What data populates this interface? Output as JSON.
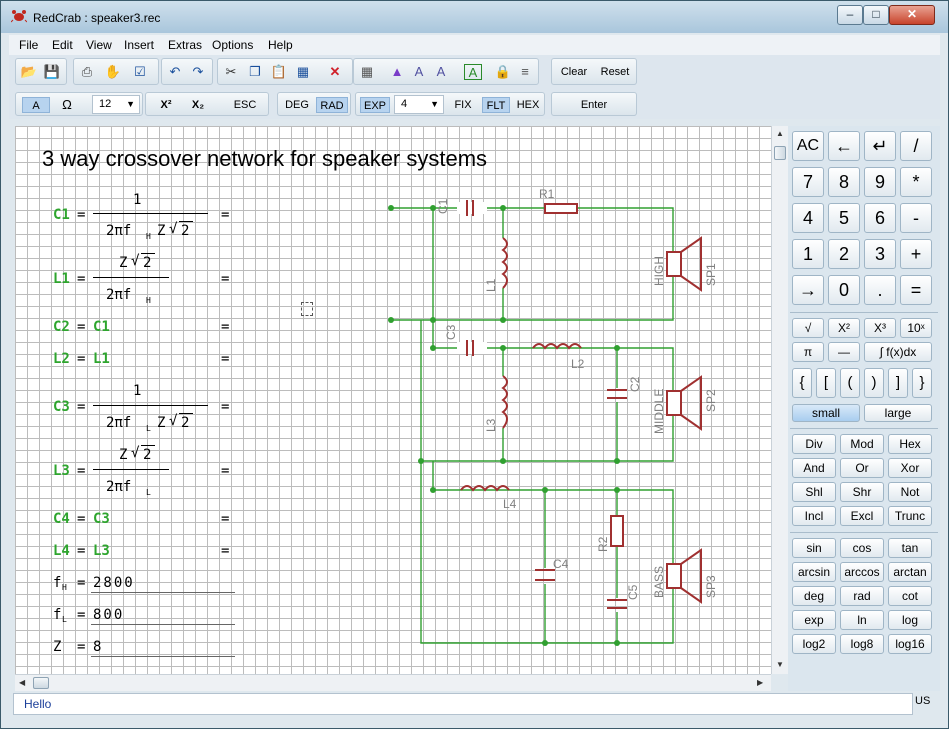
{
  "window": {
    "title": "RedCrab : speaker3.rec",
    "min_glyph": "–",
    "max_glyph": "□",
    "close_glyph": "✕"
  },
  "menu": [
    "File",
    "Edit",
    "View",
    "Insert",
    "Extras",
    "Options",
    "Help"
  ],
  "toolbar1": {
    "clear": "Clear",
    "reset": "Reset"
  },
  "toolbar2": {
    "font_a": "A",
    "omega": "Ω",
    "font_size": "12",
    "superscript": "X²",
    "subscript": "X₂",
    "esc": "ESC",
    "deg": "DEG",
    "rad": "RAD",
    "exp": "EXP",
    "digits": "4",
    "fix": "FIX",
    "flt": "FLT",
    "hex": "HEX",
    "enter": "Enter"
  },
  "document": {
    "title": "3 way crossover network for speaker systems",
    "eq": {
      "c1": "C1",
      "l1": "L1",
      "c2": "C2",
      "l2": "L2",
      "c3": "C3",
      "l3": "L3",
      "c4": "C4",
      "l4": "L4",
      "one": "1",
      "twopi": "2πf",
      "h": "H",
      "l": "L",
      "z": "Z",
      "two": "2",
      "eqsign": "=",
      "fh": "f",
      "fl": "f",
      "zvar": "Z",
      "fh_val": "2800",
      "fl_val": "800",
      "z_val": "8"
    },
    "circuit": {
      "c1": "C1",
      "r1": "R1",
      "l1": "L1",
      "high": "HIGH",
      "sp1": "SP1",
      "c3": "C3",
      "l2": "L2",
      "c2": "C2",
      "l3": "L3",
      "middle": "MIDDLE",
      "sp2": "SP2",
      "l4": "L4",
      "r2": "R2",
      "c4": "C4",
      "c5": "C5",
      "bass": "BASS",
      "sp3": "SP3"
    }
  },
  "calculator": {
    "row1": [
      "AC",
      "←",
      "↵",
      "/"
    ],
    "row2": [
      "7",
      "8",
      "9",
      "*"
    ],
    "row3": [
      "4",
      "5",
      "6",
      "-"
    ],
    "row4": [
      "1",
      "2",
      "3",
      "+"
    ],
    "row5": [
      "→",
      "0",
      ".",
      "="
    ],
    "fn1": [
      "√",
      "X²",
      "X³",
      "10ˣ"
    ],
    "fn2": [
      "π",
      "—",
      "∫ f(x)dx"
    ],
    "brackets": [
      "{",
      "[",
      "(",
      ")",
      "]",
      "}"
    ],
    "size": [
      "small",
      "large"
    ],
    "ops": [
      "Div",
      "Mod",
      "Hex",
      "And",
      "Or",
      "Xor",
      "Shl",
      "Shr",
      "Not",
      "Incl",
      "Excl",
      "Trunc"
    ],
    "trig": [
      "sin",
      "cos",
      "tan",
      "arcsin",
      "arccos",
      "arctan",
      "deg",
      "rad",
      "cot",
      "exp",
      "ln",
      "log",
      "log2",
      "log8",
      "log16"
    ]
  },
  "status": {
    "message": "Hello",
    "lang": "US"
  },
  "colors": {
    "accent": "#2ea52e",
    "component": "#a03030",
    "wire": "#30a030"
  }
}
